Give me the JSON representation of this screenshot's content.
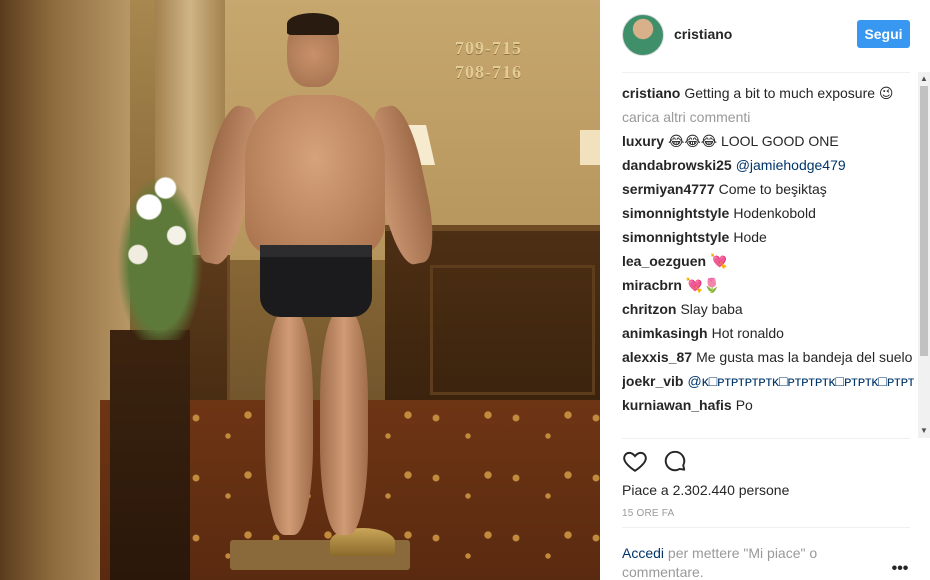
{
  "photo": {
    "room_number_1": "709-715",
    "room_number_2": "708-716"
  },
  "post": {
    "username": "cristiano",
    "follow_label": "Segui",
    "caption_user": "cristiano",
    "caption_text": "Getting a bit to much exposure 😉",
    "load_more": "carica altri commenti"
  },
  "comments": [
    {
      "user": "luxury",
      "text": "😂😂😂 LOOL GOOD ONE"
    },
    {
      "user": "dandabrowski25",
      "text": "@jamiehodge479"
    },
    {
      "user": "sermiyan4777",
      "text": "Come to beşiktaş"
    },
    {
      "user": "simonnightstyle",
      "text": "Hodenkobold"
    },
    {
      "user": "simonnightstyle",
      "text": "Hode"
    },
    {
      "user": "lea_oezguen",
      "text": "💘"
    },
    {
      "user": "miracbrn",
      "text": "💘🌷"
    },
    {
      "user": "chritzon",
      "text": "Slay baba"
    },
    {
      "user": "animkasingh",
      "text": "Hot ronaldo"
    },
    {
      "user": "alexxis_87",
      "text": "Me gusta mas la bandeja del suelo"
    },
    {
      "user": "joekr_vib",
      "text": "@ᴋ□ᴘᴛᴘᴛᴘᴛᴘᴛᴋ□ᴘᴛᴘᴛᴘᴛᴋ□ᴘᴛᴘᴛᴋ□ᴘᴛᴘᴛ"
    },
    {
      "user": "kurniawan_hafis",
      "text": "Po"
    }
  ],
  "actions": {
    "like_icon": "heart-icon",
    "comment_icon": "comment-bubble-icon"
  },
  "stats": {
    "likes_text": "Piace a 2.302.440 persone",
    "timestamp": "15 ORE FA"
  },
  "login": {
    "link": "Accedi",
    "text": " per mettere \"Mi piace\" o commentare."
  },
  "more_label": "•••",
  "colors": {
    "accent": "#3897f0",
    "link": "#003569",
    "muted": "#999999",
    "text": "#262626"
  }
}
